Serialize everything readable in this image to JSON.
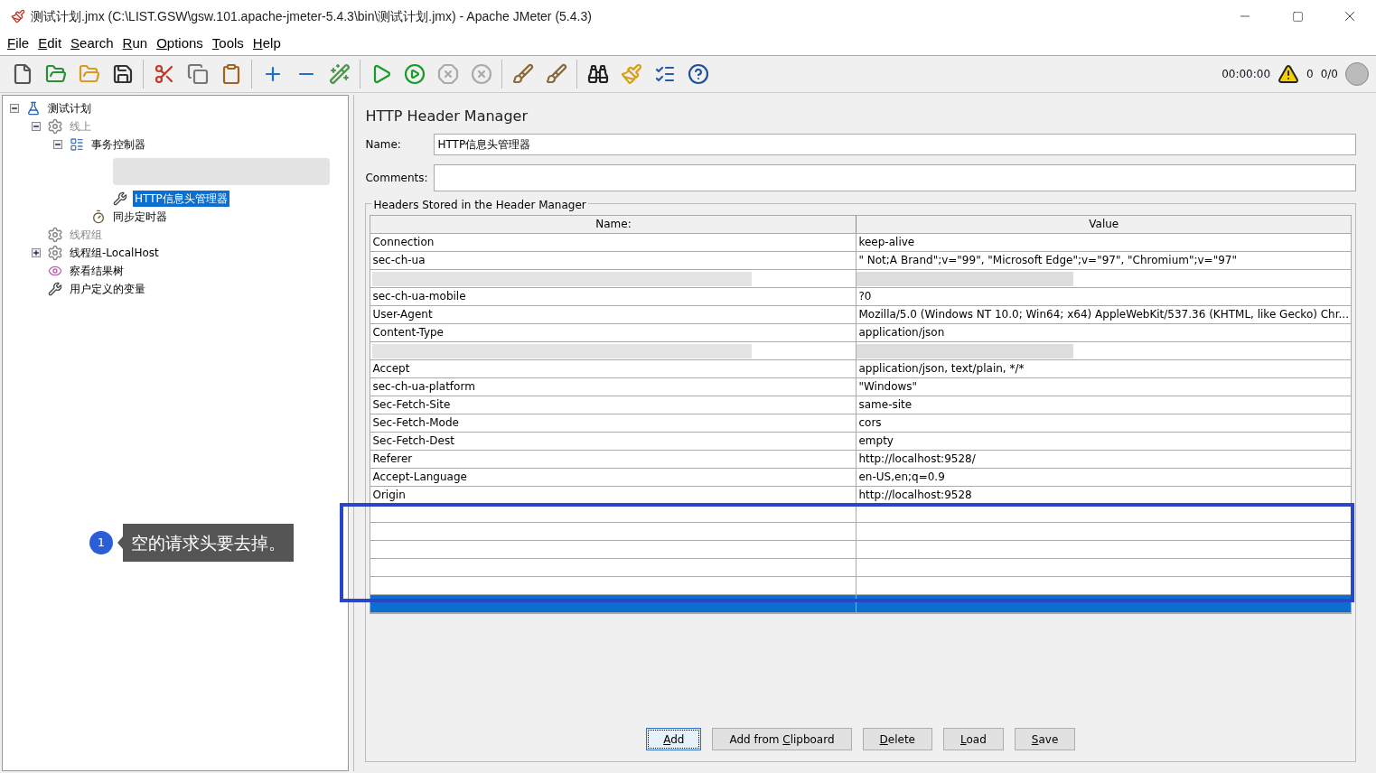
{
  "window": {
    "title": "测试计划.jmx (C:\\LIST.GSW\\gsw.101.apache-jmeter-5.4.3\\bin\\测试计划.jmx) - Apache JMeter (5.4.3)"
  },
  "menu": [
    "File",
    "Edit",
    "Search",
    "Run",
    "Options",
    "Tools",
    "Help"
  ],
  "status": {
    "time": "00:00:00",
    "warnings": "0",
    "threads": "0/0"
  },
  "tree": [
    {
      "label": "测试计划",
      "kind": "plan",
      "expanded": true,
      "disabled": false,
      "selected": false,
      "children": [
        {
          "label": "线上",
          "kind": "group",
          "expanded": true,
          "disabled": true,
          "selected": false,
          "children": [
            {
              "label": "事务控制器",
              "kind": "controller",
              "expanded": true,
              "disabled": false,
              "selected": false,
              "children": [
                {
                  "kind": "redacted",
                  "children": [
                    {
                      "label": "HTTP信息头管理器",
                      "kind": "config",
                      "disabled": false,
                      "selected": true
                    }
                  ]
                },
                {
                  "label": "同步定时器",
                  "kind": "timer",
                  "disabled": false,
                  "selected": false
                }
              ]
            }
          ]
        },
        {
          "label": "线程组",
          "kind": "group",
          "disabled": true,
          "selected": false
        },
        {
          "label": "线程组-LocalHost",
          "kind": "group",
          "expanded": false,
          "disabled": false,
          "selected": false
        },
        {
          "label": "察看结果树",
          "kind": "listener",
          "disabled": false,
          "selected": false
        },
        {
          "label": "用户定义的变量",
          "kind": "config",
          "disabled": false,
          "selected": false
        }
      ]
    }
  ],
  "panel": {
    "title": "HTTP Header Manager",
    "name_label": "Name:",
    "name_value": "HTTP信息头管理器",
    "comments_label": "Comments:",
    "group_title": "Headers Stored in the Header Manager",
    "columns": [
      "Name:",
      "Value"
    ],
    "rows": [
      {
        "kind": "header",
        "name": "Connection",
        "value": "keep-alive",
        "selected": false
      },
      {
        "kind": "header",
        "name": "sec-ch-ua",
        "value": "\" Not;A Brand\";v=\"99\", \"Microsoft Edge\";v=\"97\", \"Chromium\";v=\"97\"",
        "selected": false
      },
      {
        "kind": "redacted",
        "selected": false
      },
      {
        "kind": "header",
        "name": "sec-ch-ua-mobile",
        "value": "?0",
        "selected": false
      },
      {
        "kind": "header",
        "name": "User-Agent",
        "value": "Mozilla/5.0 (Windows NT 10.0; Win64; x64) AppleWebKit/537.36 (KHTML, like Gecko) Chr...",
        "selected": false
      },
      {
        "kind": "header",
        "name": "Content-Type",
        "value": "application/json",
        "selected": false
      },
      {
        "kind": "redacted",
        "selected": false
      },
      {
        "kind": "header",
        "name": "Accept",
        "value": "application/json, text/plain, */*",
        "selected": false
      },
      {
        "kind": "header",
        "name": "sec-ch-ua-platform",
        "value": "\"Windows\"",
        "selected": false
      },
      {
        "kind": "header",
        "name": "Sec-Fetch-Site",
        "value": "same-site",
        "selected": false
      },
      {
        "kind": "header",
        "name": "Sec-Fetch-Mode",
        "value": "cors",
        "selected": false
      },
      {
        "kind": "header",
        "name": "Sec-Fetch-Dest",
        "value": "empty",
        "selected": false
      },
      {
        "kind": "header",
        "name": "Referer",
        "value": "http://localhost:9528/",
        "selected": false
      },
      {
        "kind": "header",
        "name": "Accept-Language",
        "value": "en-US,en;q=0.9",
        "selected": false
      },
      {
        "kind": "header",
        "name": "Origin",
        "value": "http://localhost:9528",
        "selected": false
      },
      {
        "kind": "empty",
        "selected": false
      },
      {
        "kind": "empty",
        "selected": false
      },
      {
        "kind": "empty",
        "selected": false
      },
      {
        "kind": "empty",
        "selected": false
      },
      {
        "kind": "empty",
        "selected": false
      },
      {
        "kind": "empty",
        "selected": true
      }
    ],
    "buttons": [
      {
        "mnemonic": "A",
        "post": "dd",
        "focused": true
      },
      {
        "pre": "Add from ",
        "mnemonic": "C",
        "post": "lipboard",
        "focused": false
      },
      {
        "mnemonic": "D",
        "post": "elete",
        "focused": false
      },
      {
        "mnemonic": "L",
        "post": "oad",
        "focused": false
      },
      {
        "mnemonic": "S",
        "post": "ave",
        "focused": false
      }
    ]
  },
  "annotation": {
    "number": "1",
    "text": "空的请求头要去掉。"
  }
}
